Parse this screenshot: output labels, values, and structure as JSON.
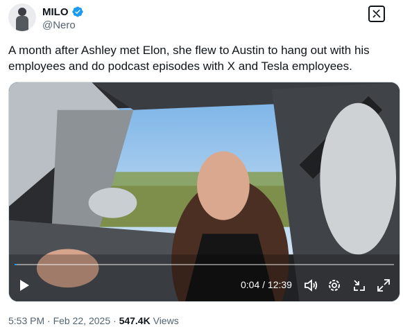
{
  "header": {
    "display_name": "MILO",
    "handle": "@Nero",
    "verified": true
  },
  "tweet": {
    "text": "A month after Ashley met Elon, she flew to Austin to hang out with his employees and do podcast episodes with X and Tesla employees."
  },
  "video": {
    "current_time": "0:04",
    "duration": "12:39",
    "time_display": "0:04 / 12:39",
    "progress_fraction": 0.005,
    "icons": [
      "play-icon",
      "volume-icon",
      "settings-icon",
      "pip-icon",
      "fullscreen-icon"
    ]
  },
  "meta": {
    "time": "5:53 PM",
    "separator": "·",
    "date": "Feb 22, 2025",
    "views_count": "547.4K",
    "views_label": "Views"
  },
  "colors": {
    "accent": "#1d9bf0",
    "text_primary": "#0f1419",
    "text_secondary": "#536471"
  }
}
